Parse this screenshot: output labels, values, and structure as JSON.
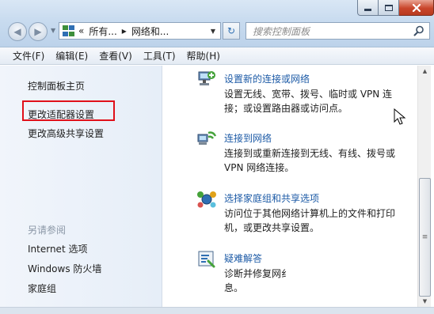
{
  "window": {
    "minimize_icon": "minimize-icon",
    "maximize_icon": "maximize-icon",
    "close_icon": "close-icon"
  },
  "addressbar": {
    "prefix": "«",
    "segments": [
      "所有...",
      "网络和..."
    ],
    "separator": "▸"
  },
  "search": {
    "placeholder": "搜索控制面板"
  },
  "menu": {
    "items": [
      "文件(F)",
      "编辑(E)",
      "查看(V)",
      "工具(T)",
      "帮助(H)"
    ]
  },
  "sidebar": {
    "links": [
      "控制面板主页",
      "更改适配器设置",
      "更改高级共享设置"
    ],
    "see_also_heading": "另请参阅",
    "see_also": [
      "Internet 选项",
      "Windows 防火墙",
      "家庭组"
    ]
  },
  "tasks": [
    {
      "title": "设置新的连接或网络",
      "desc": [
        "设置无线、宽带、拨号、临时或 VPN 连",
        "接；或设置路由器或访问点。"
      ],
      "icon": "setup-connection-icon"
    },
    {
      "title": "连接到网络",
      "desc": [
        "连接到或重新连接到无线、有线、拨号或",
        "VPN 网络连接。"
      ],
      "icon": "connect-network-icon"
    },
    {
      "title": "选择家庭组和共享选项",
      "desc": [
        "访问位于其他网络计算机上的文件和打印",
        "机，或更改共享设置。"
      ],
      "icon": "homegroup-icon"
    },
    {
      "title": "疑难解答",
      "desc": [
        "诊断并修复网纟",
        "息。"
      ],
      "icon": "troubleshoot-icon"
    }
  ],
  "colors": {
    "link_blue": "#1c5aa6",
    "highlight_red": "#e0101a",
    "see_also_gray": "#8b97a6"
  }
}
